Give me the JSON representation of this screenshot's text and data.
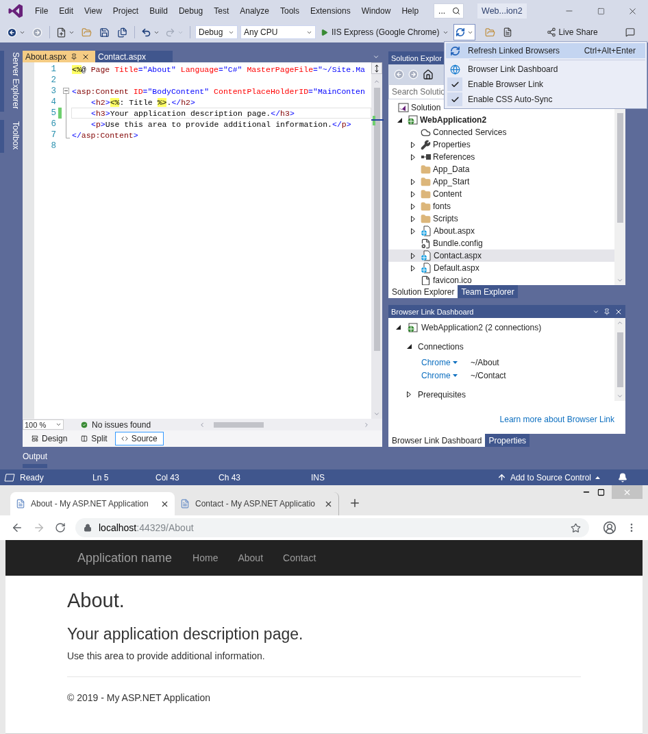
{
  "title_bar": {
    "menu": [
      "File",
      "Edit",
      "View",
      "Project",
      "Build",
      "Debug",
      "Test",
      "Analyze",
      "Tools",
      "Extensions",
      "Window",
      "Help"
    ],
    "search": {
      "placeholder": "..."
    },
    "solution_name": "Web...ion2"
  },
  "toolbar": {
    "configuration": "Debug",
    "platform": "Any CPU",
    "run_target": "IIS Express (Google Chrome)",
    "live_share": "Live Share"
  },
  "side_tabs": [
    "Server Explorer",
    "Toolbox"
  ],
  "editor": {
    "tabs": [
      {
        "label": "About.aspx",
        "selected": true
      },
      {
        "label": "Contact.aspx",
        "selected": false
      }
    ],
    "lines": [
      {
        "number": "1",
        "current": false,
        "modified": false,
        "indented": false,
        "fold_start": false,
        "in_fold": false,
        "tokens": [
          {
            "kind": "delim",
            "text": "<%"
          },
          {
            "kind": "plain",
            "text": "@ "
          },
          {
            "kind": "tag",
            "text": "Page"
          },
          {
            "kind": "attr",
            "text": " Title"
          },
          {
            "kind": "value",
            "text": "=\"About\""
          },
          {
            "kind": "attr",
            "text": " Language"
          },
          {
            "kind": "value",
            "text": "=\"C#\""
          },
          {
            "kind": "attr",
            "text": " MasterPageFile"
          },
          {
            "kind": "value",
            "text": "=\"~/Site.Ma"
          }
        ]
      },
      {
        "number": "2",
        "current": false,
        "modified": false,
        "fold_start": false,
        "in_fold": false
      },
      {
        "number": "3",
        "current": false,
        "modified": false,
        "indented": false,
        "fold_start": true,
        "in_fold": false,
        "tokens": [
          {
            "kind": "punct",
            "text": "<"
          },
          {
            "kind": "tag",
            "text": "asp:Content"
          },
          {
            "kind": "attr",
            "text": " ID"
          },
          {
            "kind": "value",
            "text": "=\"BodyContent\""
          },
          {
            "kind": "attr",
            "text": " ContentPlaceHolderID"
          },
          {
            "kind": "value",
            "text": "=\"MainConten"
          }
        ]
      },
      {
        "number": "4",
        "current": false,
        "modified": false,
        "indented": true,
        "fold_start": false,
        "in_fold": true,
        "tokens": [
          {
            "kind": "punct",
            "text": "<"
          },
          {
            "kind": "tag",
            "text": "h2"
          },
          {
            "kind": "punct",
            "text": ">"
          },
          {
            "kind": "delim",
            "text": "<%"
          },
          {
            "kind": "plain",
            "text": ": Title "
          },
          {
            "kind": "delim",
            "text": "%>"
          },
          {
            "kind": "plain",
            "text": "."
          },
          {
            "kind": "punct",
            "text": "</"
          },
          {
            "kind": "tag",
            "text": "h2"
          },
          {
            "kind": "punct",
            "text": ">"
          }
        ]
      },
      {
        "number": "5",
        "current": true,
        "modified": true,
        "indented": true,
        "fold_start": false,
        "in_fold": true,
        "tokens": [
          {
            "kind": "punct",
            "text": "<"
          },
          {
            "kind": "tag",
            "text": "h3"
          },
          {
            "kind": "punct",
            "text": ">"
          },
          {
            "kind": "plain",
            "text": "Your application description page."
          },
          {
            "kind": "punct",
            "text": "</"
          },
          {
            "kind": "tag",
            "text": "h3"
          },
          {
            "kind": "punct",
            "text": ">"
          }
        ]
      },
      {
        "number": "6",
        "current": false,
        "modified": false,
        "indented": true,
        "fold_start": false,
        "in_fold": true,
        "tokens": [
          {
            "kind": "punct",
            "text": "<"
          },
          {
            "kind": "tag",
            "text": "p"
          },
          {
            "kind": "punct",
            "text": ">"
          },
          {
            "kind": "plain",
            "text": "Use this area to provide additional information."
          },
          {
            "kind": "punct",
            "text": "</"
          },
          {
            "kind": "tag",
            "text": "p"
          },
          {
            "kind": "punct",
            "text": ">"
          }
        ]
      },
      {
        "number": "7",
        "current": false,
        "modified": false,
        "indented": false,
        "fold_start": false,
        "in_fold": true,
        "tokens": [
          {
            "kind": "punct",
            "text": "</"
          },
          {
            "kind": "tag",
            "text": "asp:Content"
          },
          {
            "kind": "punct",
            "text": ">"
          }
        ]
      },
      {
        "number": "8",
        "current": false,
        "modified": false,
        "fold_start": false,
        "in_fold": false
      }
    ],
    "zoom": "100 %",
    "issues": "No issues found",
    "view_tabs": [
      {
        "label": "Design",
        "kind": "design",
        "selected": false
      },
      {
        "label": "Split",
        "kind": "split",
        "selected": false
      },
      {
        "label": "Source",
        "kind": "source",
        "selected": true
      }
    ]
  },
  "solution_explorer": {
    "title": "Solution Explor",
    "search": {
      "placeholder": "Search Solutio"
    },
    "tree": [
      {
        "label": "Solution",
        "kind": "solution",
        "selected": false,
        "children": [
          {
            "label": "WebApplication2",
            "kind": "project",
            "expandable": true,
            "expanded": true,
            "selected": false,
            "children": [
              {
                "label": "Connected Services",
                "kind": "services",
                "expandable": false,
                "selected": false
              },
              {
                "label": "Properties",
                "kind": "properties",
                "expandable": true,
                "expanded": false,
                "selected": false
              },
              {
                "label": "References",
                "kind": "references",
                "expandable": true,
                "expanded": false,
                "selected": false
              },
              {
                "label": "App_Data",
                "kind": "folder",
                "expandable": false,
                "selected": false
              },
              {
                "label": "App_Start",
                "kind": "folder",
                "expandable": true,
                "expanded": false,
                "selected": false
              },
              {
                "label": "Content",
                "kind": "folder",
                "expandable": true,
                "expanded": false,
                "selected": false
              },
              {
                "label": "fonts",
                "kind": "folder",
                "expandable": true,
                "expanded": false,
                "selected": false
              },
              {
                "label": "Scripts",
                "kind": "folder",
                "expandable": true,
                "expanded": false,
                "selected": false
              },
              {
                "label": "About.aspx",
                "kind": "web-file",
                "expandable": true,
                "expanded": false,
                "selected": false
              },
              {
                "label": "Bundle.config",
                "kind": "config-file",
                "expandable": false,
                "selected": false
              },
              {
                "label": "Contact.aspx",
                "kind": "web-file",
                "expandable": true,
                "expanded": false,
                "selected": true
              },
              {
                "label": "Default.aspx",
                "kind": "web-file",
                "expandable": true,
                "expanded": false,
                "selected": false
              },
              {
                "label": "favicon.ico",
                "kind": "image-file",
                "expandable": false,
                "selected": false
              }
            ]
          }
        ]
      }
    ],
    "tabs": [
      {
        "label": "Solution Explorer",
        "selected": true
      },
      {
        "label": "Team Explorer",
        "selected": false
      }
    ]
  },
  "browser_link_menu": [
    {
      "label": "Refresh Linked Browsers",
      "shortcut": "Ctrl+Alt+Enter",
      "kind": "refresh",
      "selected": true,
      "checked": false
    },
    {
      "label": "Browser Link Dashboard",
      "kind": "dashboard",
      "selected": false,
      "checked": false
    },
    {
      "label": "Enable Browser Link",
      "kind": "toggle",
      "selected": false,
      "checked": true
    },
    {
      "label": "Enable CSS Auto-Sync",
      "kind": "toggle",
      "selected": false,
      "checked": true
    }
  ],
  "browser_link_dashboard": {
    "title": "Browser Link Dashboard",
    "project": {
      "label": "WebApplication2 (2 connections)",
      "expanded": true
    },
    "connections": {
      "label": "Connections",
      "expanded": true,
      "items": [
        {
          "browser": "Chrome",
          "path": "~/About"
        },
        {
          "browser": "Chrome",
          "path": "~/Contact"
        }
      ]
    },
    "prerequisites": {
      "label": "Prerequisites",
      "expanded": false
    },
    "link": "Learn more about Browser Link",
    "tabs": [
      {
        "label": "Browser Link Dashboard",
        "selected": true
      },
      {
        "label": "Properties",
        "selected": false
      }
    ]
  },
  "output_tab": "Output",
  "status_bar": {
    "state": "Ready",
    "line": "Ln 5",
    "column": "Col 43",
    "char": "Ch 43",
    "mode": "INS",
    "source_control": "Add to Source Control"
  },
  "browser": {
    "tabs": [
      {
        "title": "About - My ASP.NET Application",
        "selected": true
      },
      {
        "title": "Contact - My ASP.NET Applicatio",
        "selected": false
      }
    ],
    "address": {
      "host": "localhost",
      "rest": ":44329/About"
    },
    "navbar": {
      "brand": "Application name",
      "links": [
        "Home",
        "About",
        "Contact"
      ]
    },
    "page": {
      "heading": "About.",
      "subheading": "Your application description page.",
      "text": "Use this area to provide additional information.",
      "footer": "© 2019 - My ASP.NET Application"
    }
  }
}
